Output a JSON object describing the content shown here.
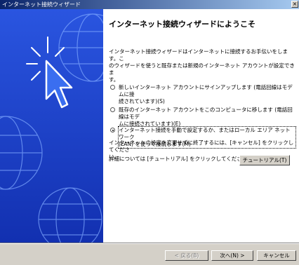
{
  "window": {
    "title": "インターネット接続ウィザード",
    "close_glyph": "×"
  },
  "heading": "インターネット接続ウィザードにようこそ",
  "intro": "インターネット接続ウィザードはインターネットに接続するお手伝いをします。こ\nのウィザードを使うと既存または新規のインターネット アカウントが設定できま\nす。",
  "options": [
    {
      "label": "新しいインターネット アカウントにサインアップします (電話回線はモデムに接\n続されています)(S)",
      "selected": false
    },
    {
      "label": "既存のインターネット アカウントをこのコンピュータに移します (電話回線はモデ\nムに接続されています)(E)",
      "selected": false
    },
    {
      "label": "インターネット接続を手動で設定するか、またはローカル エリア ネットワーク\n(LAN) を使って接続します(M)",
      "selected": true
    }
  ],
  "note": "インターネットの設定を変更せずに終了するには、[キャンセル] をクリックしてくださ\nい。",
  "tutorial_note": "詳細については [チュートリアル] をクリックしてください。",
  "buttons": {
    "tutorial": "チュートリアル(T)",
    "back": "< 戻る(B)",
    "next": "次へ(N) >",
    "cancel": "キャンセル"
  }
}
